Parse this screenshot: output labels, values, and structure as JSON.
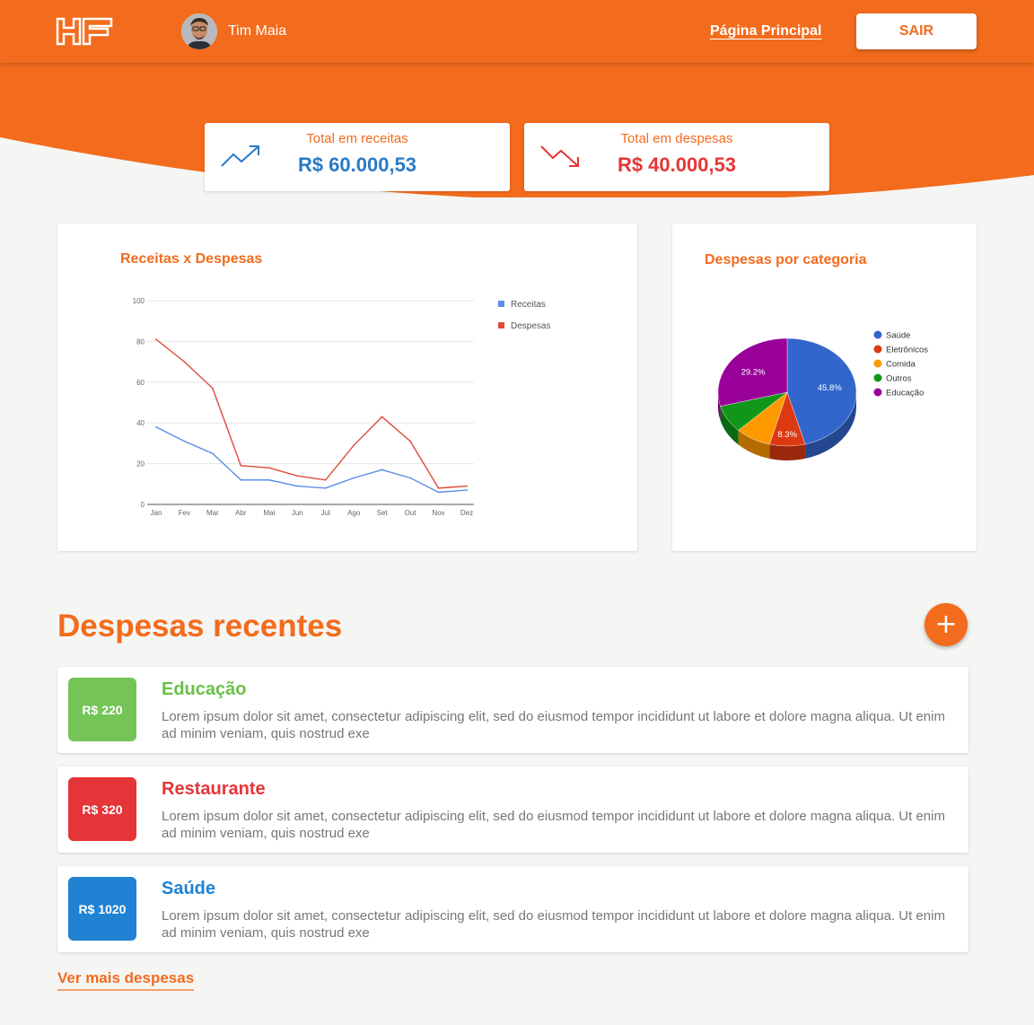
{
  "colors": {
    "brand": "#f36b1c",
    "income": "#2a7ac6",
    "expense": "#e53535",
    "chart_receitas": "#5a8fe8",
    "chart_despesas": "#dd4b39"
  },
  "header": {
    "logo_icon": "hf-logo",
    "user_name": "Tim Maia",
    "nav_home": "Página Principal",
    "logout_label": "SAIR"
  },
  "stats": {
    "income": {
      "label": "Total em receitas",
      "value": "R$ 60.000,53",
      "icon": "trending-up-icon"
    },
    "expenses": {
      "label": "Total em despesas",
      "value": "R$ 40.000,53",
      "icon": "trending-down-icon"
    }
  },
  "line_card": {
    "title": "Receitas x Despesas"
  },
  "pie_card": {
    "title": "Despesas por categoria"
  },
  "chart_data": [
    {
      "type": "line",
      "title": "Receitas x Despesas",
      "categories": [
        "Jan",
        "Fev",
        "Mar",
        "Abr",
        "Mai",
        "Jun",
        "Jul",
        "Ago",
        "Set",
        "Out",
        "Nov",
        "Dez"
      ],
      "yticks": [
        0,
        20,
        40,
        60,
        80,
        100
      ],
      "ylim": [
        0,
        100
      ],
      "grid": true,
      "legend": "right",
      "series": [
        {
          "name": "Receitas",
          "color": "#5a8fe8",
          "values": [
            38,
            31,
            25,
            12,
            12,
            9,
            8,
            13,
            17,
            13,
            6,
            7
          ]
        },
        {
          "name": "Despesas",
          "color": "#dd4b39",
          "values": [
            81,
            70,
            57,
            19,
            18,
            14,
            12,
            29,
            43,
            31,
            8,
            9
          ]
        }
      ]
    },
    {
      "type": "pie",
      "title": "Despesas por categoria",
      "legend": "right",
      "slices": [
        {
          "name": "Saúde",
          "value": 45.8,
          "label": "45.8%",
          "color": "#3366cc"
        },
        {
          "name": "Eletrônicos",
          "value": 8.3,
          "label": "8.3%",
          "color": "#dc3912"
        },
        {
          "name": "Comida",
          "value": 8.4,
          "label": "",
          "color": "#ff9900"
        },
        {
          "name": "Outros",
          "value": 8.3,
          "label": "",
          "color": "#109618"
        },
        {
          "name": "Educação",
          "value": 29.2,
          "label": "29.2%",
          "color": "#990099"
        }
      ]
    }
  ],
  "recent": {
    "title": "Despesas recentes",
    "add_button": "+",
    "items": [
      {
        "amount": "R$ 220",
        "title": "Educação",
        "color": "#74c556",
        "title_color": "#6cc04a",
        "desc": "Lorem ipsum dolor sit amet, consectetur adipiscing elit, sed do eiusmod tempor incididunt ut labore et dolore magna aliqua. Ut enim ad minim veniam, quis nostrud exe"
      },
      {
        "amount": "R$ 320",
        "title": "Restaurante",
        "color": "#e53538",
        "title_color": "#e53538",
        "desc": "Lorem ipsum dolor sit amet, consectetur adipiscing elit, sed do eiusmod tempor incididunt ut labore et dolore magna aliqua. Ut enim ad minim veniam, quis nostrud exe"
      },
      {
        "amount": "R$ 1020",
        "title": "Saúde",
        "color": "#1f82d2",
        "title_color": "#1f82d2",
        "desc": "Lorem ipsum dolor sit amet, consectetur adipiscing elit, sed do eiusmod tempor incididunt ut labore et dolore magna aliqua. Ut enim ad minim veniam, quis nostrud exe"
      }
    ],
    "more_link": "Ver mais despesas"
  }
}
